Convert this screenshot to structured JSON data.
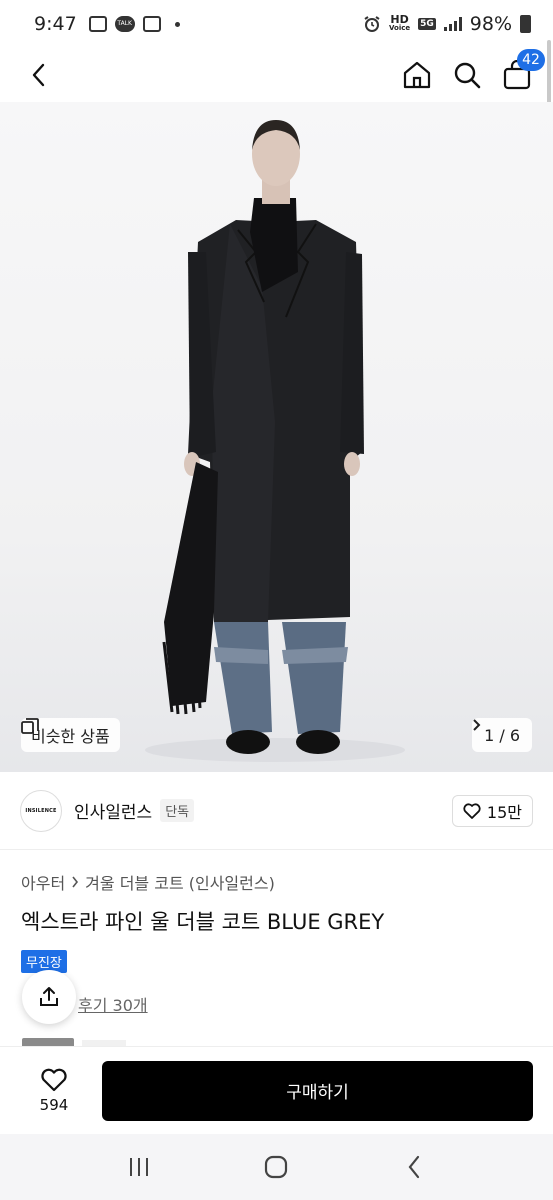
{
  "status_bar": {
    "time": "9:47",
    "talk_label": "TALK",
    "network_label": "HD",
    "voice_label": "Voice",
    "gen_label": "5G",
    "battery": "98%"
  },
  "header": {
    "cart_count": "42"
  },
  "gallery": {
    "similar_label": "비슷한 상품",
    "page_indicator": "1 / 6"
  },
  "brand": {
    "logo_text": "INSILENCE",
    "name": "인사일런스",
    "tag": "단독",
    "likes": "15만"
  },
  "product": {
    "breadcrumb": [
      "아우터",
      "겨울 더블 코트 (인사일런스)"
    ],
    "title": "엑스트라 파인 울 더블 코트 BLUE GREY",
    "badge": "무진장",
    "review_link": "후기 30개"
  },
  "bottom": {
    "wish_count": "594",
    "buy_label": "구매하기"
  },
  "colors": {
    "accent": "#1e6fe6",
    "buy_button": "#000000"
  }
}
